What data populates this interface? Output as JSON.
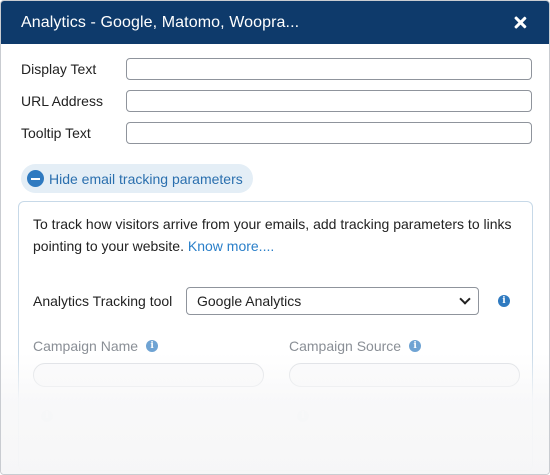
{
  "window": {
    "title": "Analytics - Google, Matomo, Woopra..."
  },
  "form": {
    "display_text_label": "Display Text",
    "display_text_value": "",
    "url_label": "URL Address",
    "url_value": "",
    "tooltip_label": "Tooltip Text",
    "tooltip_value": ""
  },
  "tracking": {
    "toggle_label": "Hide email tracking parameters",
    "description": "To track how visitors arrive from your emails, add tracking parameters to links pointing to your website.",
    "know_more": "Know more....",
    "tool_label": "Analytics Tracking tool",
    "tool_selected": "Google Analytics",
    "campaign_name_label": "Campaign Name",
    "campaign_source_label": "Campaign Source"
  },
  "icons": {
    "close": "close-icon",
    "collapse": "minus-circle-icon",
    "info": "info-icon",
    "select": "chevron-down-icon"
  },
  "colors": {
    "titlebar": "#0e3a6b",
    "accent": "#2f7ac0",
    "link": "#2a7fc9",
    "toggle_bg": "#e4eef6"
  }
}
